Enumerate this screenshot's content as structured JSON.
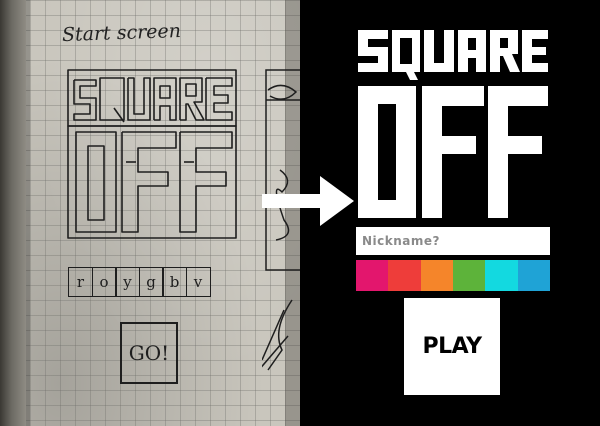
{
  "sketch": {
    "title": "Start screen",
    "logo_text": "SQUARE OFF",
    "color_letters": [
      "r",
      "o",
      "y",
      "g",
      "b",
      "v"
    ],
    "go_label": "GO!"
  },
  "app": {
    "logo_text": "SQUARE OFF",
    "nickname_placeholder": "Nickname?",
    "play_label": "PLAY",
    "swatches": [
      {
        "name": "magenta",
        "color": "#e3166d"
      },
      {
        "name": "red",
        "color": "#ee3d3a"
      },
      {
        "name": "orange",
        "color": "#f5852a"
      },
      {
        "name": "green",
        "color": "#5db33a"
      },
      {
        "name": "cyan",
        "color": "#13d9e0"
      },
      {
        "name": "blue",
        "color": "#1fa3d6"
      }
    ],
    "background": "#000000",
    "foreground": "#ffffff"
  }
}
